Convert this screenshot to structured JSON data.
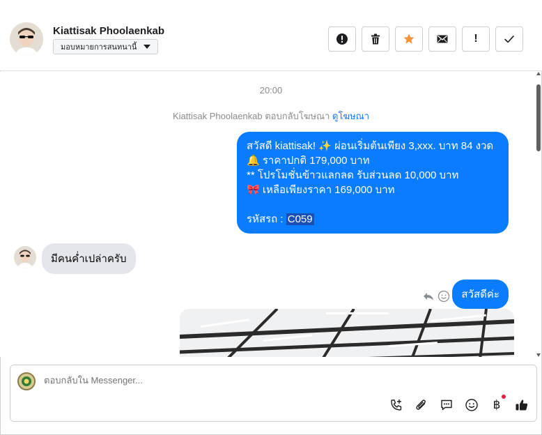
{
  "header": {
    "contact_name": "Kiattisak Phoolaenkab",
    "assign_label": "มอบหมายการสนทนานี้",
    "actions": [
      {
        "name": "report-button",
        "icon": "exclamation-circle-icon"
      },
      {
        "name": "delete-button",
        "icon": "trash-icon"
      },
      {
        "name": "star-button",
        "icon": "star-icon",
        "color": "#f7923a"
      },
      {
        "name": "mark-unread-button",
        "icon": "envelope-icon"
      },
      {
        "name": "follow-up-button",
        "icon": "exclamation-icon",
        "label": "!"
      },
      {
        "name": "done-button",
        "icon": "checkmark-icon"
      }
    ]
  },
  "conversation": {
    "timestamp": "20:00",
    "reply_note_text": "Kiattisak Phoolaenkab ตอบกลับโฆษณา",
    "reply_note_link": "ดูโฆษณา",
    "outgoing_message": {
      "line1": "สวัสดี kiattisak! ✨  ผ่อนเริ่มต้นเพียง 3,xxx. บาท 84 งวด",
      "line2": "🔔 ราคาปกติ 179,000 บาท",
      "line3": "** โปรโมชั่นข้าวแลกลด รับส่วนลด 10,000 บาท",
      "line4": "🎀  เหลือเพียงราคา 169,000 บาท",
      "code_label": "รหัสรถ : ",
      "code_value": "C059"
    },
    "incoming_message": "มีคนค่ำเปล่าครับ",
    "outgoing_message_2": "สวัสดีค่ะ"
  },
  "composer": {
    "placeholder": "ตอบกลับใน Messenger...",
    "tools": [
      "call-add-icon",
      "paperclip-icon",
      "saved-reply-icon",
      "emoji-icon",
      "baht-payment-icon",
      "thumbs-up-icon"
    ]
  },
  "colors": {
    "accent": "#0a7cff",
    "incoming_bubble": "#e4e6eb",
    "star": "#f7923a",
    "notification": "#e41e3f"
  }
}
